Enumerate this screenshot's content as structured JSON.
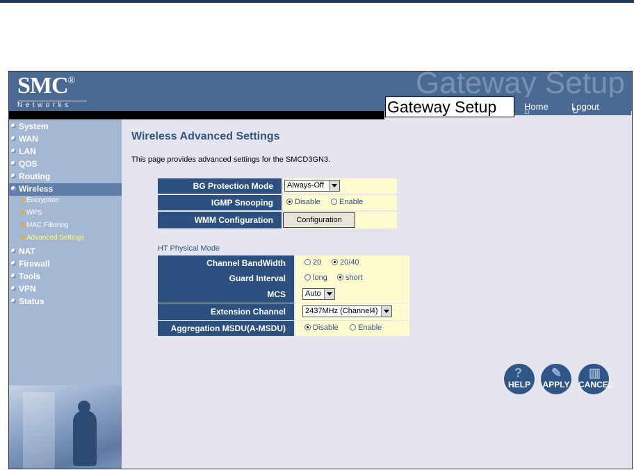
{
  "header": {
    "logo": "SMC",
    "logo_mark": "®",
    "networks": "Networks",
    "watermark": "Gateway Setup",
    "title": "Gateway Setup",
    "home": "Home",
    "logout": "Logout"
  },
  "sidebar": {
    "items": [
      {
        "label": "System"
      },
      {
        "label": "WAN"
      },
      {
        "label": "LAN"
      },
      {
        "label": "QOS"
      },
      {
        "label": "Routing"
      },
      {
        "label": "Wireless"
      },
      {
        "label": "NAT"
      },
      {
        "label": "Firewall"
      },
      {
        "label": "Tools"
      },
      {
        "label": "VPN"
      },
      {
        "label": "Status"
      }
    ],
    "subitems": [
      {
        "label": "Encryption"
      },
      {
        "label": "WPS"
      },
      {
        "label": "MAC Filtering"
      },
      {
        "label": "Advanced Settings"
      }
    ]
  },
  "main": {
    "title": "Wireless Advanced Settings",
    "description": "This page provides advanced settings for the SMCD3GN3.",
    "bg_protection": {
      "label": "BG Protection Mode",
      "value": "Always-Off"
    },
    "igmp": {
      "label": "IGMP Snooping",
      "opt1": "Disable",
      "opt2": "Enable",
      "selected": "Disable"
    },
    "wmm": {
      "label": "WMM Configuration",
      "button": "Configuration"
    },
    "ht_section": "HT Physical Mode",
    "bandwidth": {
      "label": "Channel BandWidth",
      "opt1": "20",
      "opt2": "20/40",
      "selected": "20/40"
    },
    "guard": {
      "label": "Guard Interval",
      "opt1": "long",
      "opt2": "short",
      "selected": "short"
    },
    "mcs": {
      "label": "MCS",
      "value": "Auto"
    },
    "ext_channel": {
      "label": "Extension Channel",
      "value": "2437MHz (Channel4)"
    },
    "amsdu": {
      "label": "Aggregation MSDU(A-MSDU)",
      "opt1": "Disable",
      "opt2": "Enable",
      "selected": "Disable"
    }
  },
  "actions": {
    "help": "HELP",
    "apply": "APPLY",
    "cancel": "CANCEL"
  },
  "colors": {
    "header": "#4a6a93",
    "sidebar": "#a4b8d4",
    "label_bg": "#2c5180",
    "value_bg": "#fffcd0",
    "content_bg": "#e4e5ee"
  }
}
